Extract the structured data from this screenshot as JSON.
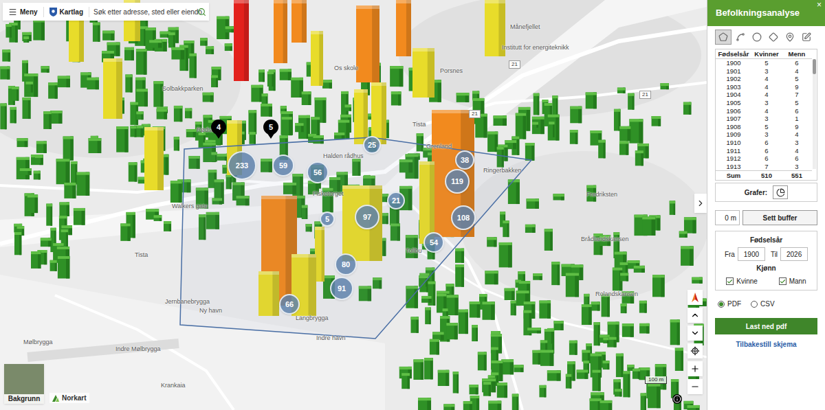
{
  "topbar": {
    "menu": "Meny",
    "layers": "Kartlag",
    "search_placeholder": "Søk etter adresse, sted eller eiendo"
  },
  "map": {
    "clusters": [
      {
        "count": "233"
      },
      {
        "count": "59"
      },
      {
        "count": "56"
      },
      {
        "count": "25"
      },
      {
        "count": "38"
      },
      {
        "count": "119"
      },
      {
        "count": "21"
      },
      {
        "count": "5"
      },
      {
        "count": "97"
      },
      {
        "count": "108"
      },
      {
        "count": "54"
      },
      {
        "count": "80"
      },
      {
        "count": "91"
      },
      {
        "count": "66"
      }
    ],
    "pins": [
      {
        "label": "4"
      },
      {
        "label": "5"
      }
    ],
    "labels": [
      "Månefjellet",
      "Institutt for energiteknikk",
      "Os skole",
      "Porsnes",
      "Solbakkparken",
      "Rødsbe",
      "Halden rådhus",
      "Fisketorget",
      "Grenland",
      "Tista",
      "Ringerbakken",
      "Walkers gate",
      "Tista",
      "Tollbu",
      "Fredriksten",
      "Brådlandskansen",
      "Rolandskansen",
      "Jernbanebrygga",
      "Ny havn",
      "Langbrygga",
      "Indre havn",
      "Mølbrygga",
      "Indre Mølbrygga",
      "Krankaia"
    ],
    "road_numbers": [
      "21",
      "21",
      "21"
    ],
    "towers": [
      {
        "color": "#e3211c"
      },
      {
        "color": "#f28a1e"
      },
      {
        "color": "#f28a1e"
      },
      {
        "color": "#f28a1e"
      },
      {
        "color": "#f28a1e"
      },
      {
        "color": "#e8dc2a"
      },
      {
        "color": "#e8dc2a"
      },
      {
        "color": "#e8dc2a"
      },
      {
        "color": "#e8dc2a"
      },
      {
        "color": "#e8dc2a"
      },
      {
        "color": "#e8dc2a"
      },
      {
        "color": "#e8dc2a"
      },
      {
        "color": "#e8dc2a"
      },
      {
        "color": "#e8dc2a"
      },
      {
        "color": "#f28a1e"
      },
      {
        "color": "#e8dc2a"
      },
      {
        "color": "#f28a1e"
      },
      {
        "color": "#e8dc2a"
      },
      {
        "color": "#e8dc2a"
      },
      {
        "color": "#e8dc2a"
      },
      {
        "color": "#e8dc2a"
      },
      {
        "color": "#e8dc2a"
      }
    ],
    "background_button": "Bakgrunn",
    "brand": "Norkart",
    "scale": "100 m"
  },
  "panel": {
    "title": "Befolkningsanalyse",
    "close": "×",
    "tools": [
      {
        "selected": true
      },
      {
        "selected": false
      },
      {
        "selected": false
      },
      {
        "selected": false
      },
      {
        "selected": false
      },
      {
        "selected": false
      }
    ],
    "table": {
      "columns": [
        "Fødselsår",
        "Kvinner",
        "Menn"
      ],
      "rows": [
        [
          "1900",
          "5",
          "6"
        ],
        [
          "1901",
          "3",
          "4"
        ],
        [
          "1902",
          "4",
          "5"
        ],
        [
          "1903",
          "4",
          "9"
        ],
        [
          "1904",
          "4",
          "7"
        ],
        [
          "1905",
          "3",
          "5"
        ],
        [
          "1906",
          "4",
          "6"
        ],
        [
          "1907",
          "3",
          "1"
        ],
        [
          "1908",
          "5",
          "9"
        ],
        [
          "1909",
          "3",
          "4"
        ],
        [
          "1910",
          "6",
          "3"
        ],
        [
          "1911",
          "6",
          "4"
        ],
        [
          "1912",
          "6",
          "6"
        ],
        [
          "1913",
          "7",
          "3"
        ]
      ],
      "sum": [
        "Sum",
        "510",
        "551"
      ]
    },
    "graphs_label": "Grafer:",
    "buffer_value": "0 m",
    "buffer_button": "Sett buffer",
    "birth_year": {
      "label": "Fødselsår",
      "from_label": "Fra",
      "from_value": "1900",
      "to_label": "Til",
      "to_value": "2026"
    },
    "gender": {
      "label": "Kjønn",
      "options": [
        {
          "label": "Kvinne",
          "checked": true
        },
        {
          "label": "Mann",
          "checked": true
        }
      ]
    },
    "formats": [
      {
        "label": "PDF",
        "selected": true
      },
      {
        "label": "CSV",
        "selected": false
      }
    ],
    "download_button": "Last ned pdf",
    "reset_link": "Tilbakestill skjema"
  }
}
